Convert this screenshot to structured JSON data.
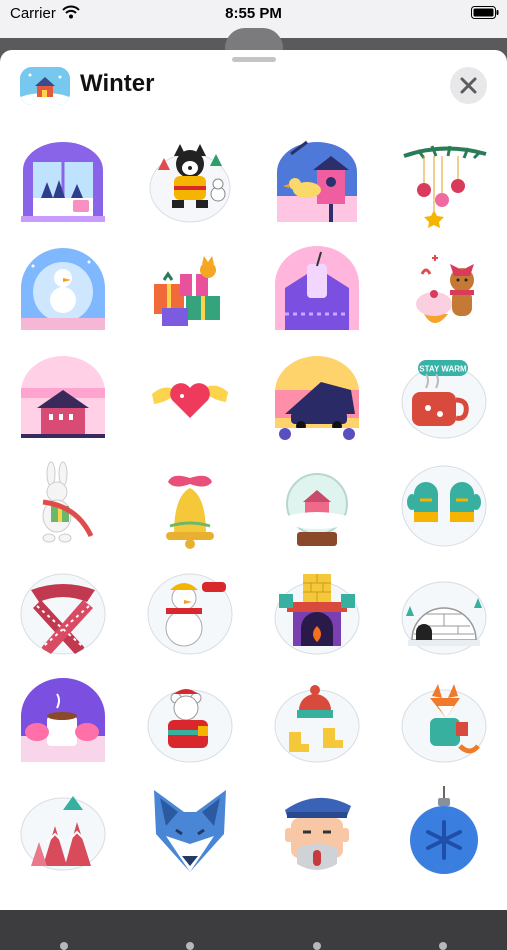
{
  "status_bar": {
    "carrier": "Carrier",
    "time": "8:55 PM"
  },
  "sheet": {
    "title": "Winter"
  },
  "stickers": [
    {
      "name": "sticker-window-snow-mug",
      "icon": "window-snow-mug"
    },
    {
      "name": "sticker-husky-sweater",
      "icon": "husky-sweater"
    },
    {
      "name": "sticker-birdhouse",
      "icon": "birdhouse"
    },
    {
      "name": "sticker-ornaments-branch",
      "icon": "ornaments-branch"
    },
    {
      "name": "sticker-snowman-globe",
      "icon": "snowman-globe"
    },
    {
      "name": "sticker-gift-boxes-cat",
      "icon": "gift-boxes"
    },
    {
      "name": "sticker-sweater-drink",
      "icon": "sweater-drink"
    },
    {
      "name": "sticker-gingerbread-cupcake",
      "icon": "gingerbread"
    },
    {
      "name": "sticker-pink-barn",
      "icon": "barn"
    },
    {
      "name": "sticker-winged-heart",
      "icon": "winged-heart"
    },
    {
      "name": "sticker-night-car",
      "icon": "night-car"
    },
    {
      "name": "sticker-stay-warm-mug",
      "icon": "stay-warm-mug",
      "text": "STAY WARM"
    },
    {
      "name": "sticker-bunny-gift",
      "icon": "bunny"
    },
    {
      "name": "sticker-bell-bow",
      "icon": "bell"
    },
    {
      "name": "sticker-snow-globe-house",
      "icon": "snow-globe"
    },
    {
      "name": "sticker-mittens",
      "icon": "mittens"
    },
    {
      "name": "sticker-knitted-scarf",
      "icon": "scarf"
    },
    {
      "name": "sticker-snowman-sign",
      "icon": "snowman-sign"
    },
    {
      "name": "sticker-fireplace",
      "icon": "fireplace"
    },
    {
      "name": "sticker-igloo",
      "icon": "igloo"
    },
    {
      "name": "sticker-cocoa-mug-hands",
      "icon": "cocoa-mug"
    },
    {
      "name": "sticker-bear-sweater",
      "icon": "bear"
    },
    {
      "name": "sticker-hat-boots",
      "icon": "hat-boots"
    },
    {
      "name": "sticker-fox-mug",
      "icon": "fox"
    },
    {
      "name": "sticker-pine-trees",
      "icon": "pine-trees"
    },
    {
      "name": "sticker-wolf-head",
      "icon": "wolf"
    },
    {
      "name": "sticker-old-man-cap",
      "icon": "old-man"
    },
    {
      "name": "sticker-blue-ornament",
      "icon": "blue-ornament"
    }
  ],
  "colors": {
    "sheet": "#ffffff",
    "close_button": "#e8e8ea",
    "page_dot": "#b8b8ba"
  }
}
